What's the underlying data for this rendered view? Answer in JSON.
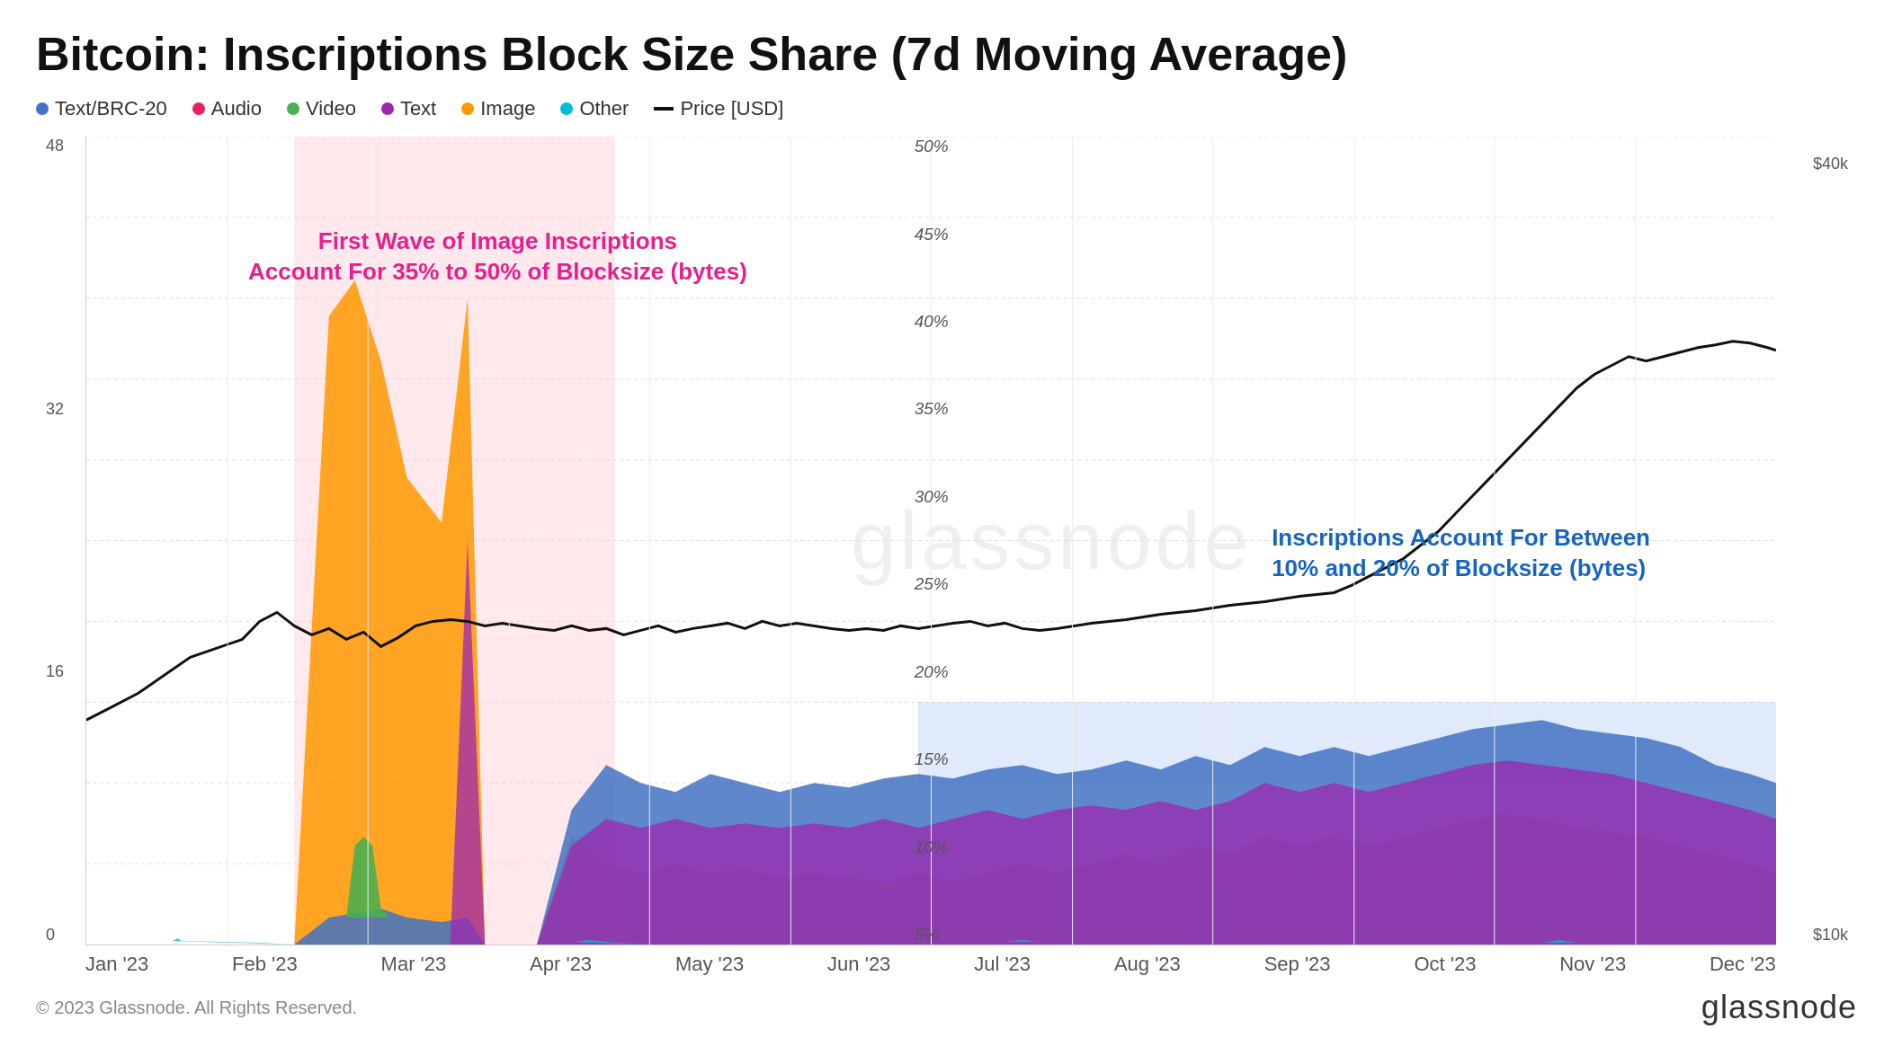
{
  "title": "Bitcoin: Inscriptions Block Size Share (7d Moving Average)",
  "legend": {
    "items": [
      {
        "label": "Text/BRC-20",
        "color": "#4472C4"
      },
      {
        "label": "Audio",
        "color": "#E91E63"
      },
      {
        "label": "Video",
        "color": "#4CAF50"
      },
      {
        "label": "Text",
        "color": "#9C27B0"
      },
      {
        "label": "Image",
        "color": "#FF9800"
      },
      {
        "label": "Other",
        "color": "#00BCD4"
      },
      {
        "label": "Price [USD]",
        "color": "#111111"
      }
    ]
  },
  "annotations": {
    "pink": {
      "line1": "First Wave of Image Inscriptions",
      "line2": "Account For 35% to 50% of Blocksize (bytes)"
    },
    "blue": {
      "line1": "Inscriptions Account For Between",
      "line2": "10% and 20% of Blocksize (bytes)"
    }
  },
  "y_axis_left": [
    "0",
    "16",
    "32",
    "48"
  ],
  "y_axis_right": [
    "$10k",
    "$40k"
  ],
  "y_axis_pct": [
    "5%",
    "10%",
    "15%",
    "20%",
    "25%",
    "30%",
    "35%",
    "40%",
    "45%",
    "50%"
  ],
  "x_labels": [
    "Jan '23",
    "Feb '23",
    "Mar '23",
    "Apr '23",
    "May '23",
    "Jun '23",
    "Jul '23",
    "Aug '23",
    "Sep '23",
    "Oct '23",
    "Nov '23",
    "Dec '23"
  ],
  "watermark": "glassnode",
  "footer": {
    "copyright": "© 2023 Glassnode. All Rights Reserved.",
    "brand": "glassnode"
  }
}
